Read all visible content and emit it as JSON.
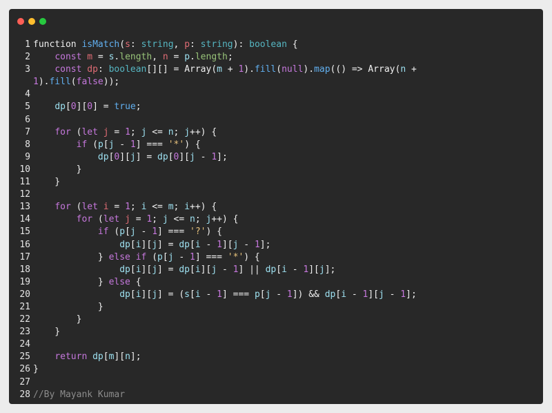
{
  "window": {
    "controls": [
      {
        "name": "close-dot",
        "color": "#ff5f56"
      },
      {
        "name": "minimize-dot",
        "color": "#ffbd2e"
      },
      {
        "name": "maximize-dot",
        "color": "#27c93f"
      }
    ]
  },
  "code": {
    "lines": [
      {
        "n": "1",
        "tokens": [
          [
            "plain",
            "function "
          ],
          [
            "fn",
            "isMatch"
          ],
          [
            "plain",
            "("
          ],
          [
            "var",
            "s"
          ],
          [
            "plain",
            ": "
          ],
          [
            "type",
            "string"
          ],
          [
            "plain",
            ", "
          ],
          [
            "var",
            "p"
          ],
          [
            "plain",
            ": "
          ],
          [
            "type",
            "string"
          ],
          [
            "plain",
            "): "
          ],
          [
            "type",
            "boolean"
          ],
          [
            "plain",
            " {"
          ]
        ]
      },
      {
        "n": "2",
        "tokens": [
          [
            "plain",
            "    "
          ],
          [
            "kw",
            "const "
          ],
          [
            "var",
            "m"
          ],
          [
            "plain",
            " = "
          ],
          [
            "idx",
            "s"
          ],
          [
            "plain",
            "."
          ],
          [
            "prop",
            "length"
          ],
          [
            "plain",
            ", "
          ],
          [
            "var",
            "n"
          ],
          [
            "plain",
            " = "
          ],
          [
            "idx",
            "p"
          ],
          [
            "plain",
            "."
          ],
          [
            "prop",
            "length"
          ],
          [
            "plain",
            ";"
          ]
        ]
      },
      {
        "n": "3",
        "tokens": [
          [
            "plain",
            "    "
          ],
          [
            "kw",
            "const "
          ],
          [
            "var",
            "dp"
          ],
          [
            "plain",
            ": "
          ],
          [
            "type",
            "boolean"
          ],
          [
            "plain",
            "[][] = "
          ],
          [
            "fnplain",
            "Array"
          ],
          [
            "plain",
            "("
          ],
          [
            "idx",
            "m"
          ],
          [
            "plain",
            " + "
          ],
          [
            "num",
            "1"
          ],
          [
            "plain",
            ")."
          ],
          [
            "fn",
            "fill"
          ],
          [
            "plain",
            "("
          ],
          [
            "kw",
            "null"
          ],
          [
            "plain",
            ")."
          ],
          [
            "fn",
            "map"
          ],
          [
            "plain",
            "(() => "
          ],
          [
            "fnplain",
            "Array"
          ],
          [
            "plain",
            "("
          ],
          [
            "idx",
            "n"
          ],
          [
            "plain",
            " +"
          ]
        ]
      },
      {
        "n": "",
        "cont": true,
        "tokens": [
          [
            "num",
            "1"
          ],
          [
            "plain",
            ")."
          ],
          [
            "fn",
            "fill"
          ],
          [
            "plain",
            "("
          ],
          [
            "kw",
            "false"
          ],
          [
            "plain",
            "));"
          ]
        ]
      },
      {
        "n": "4",
        "tokens": []
      },
      {
        "n": "5",
        "tokens": [
          [
            "plain",
            "    "
          ],
          [
            "idx",
            "dp"
          ],
          [
            "plain",
            "["
          ],
          [
            "num",
            "0"
          ],
          [
            "plain",
            "]["
          ],
          [
            "num",
            "0"
          ],
          [
            "plain",
            "] = "
          ],
          [
            "lit",
            "true"
          ],
          [
            "plain",
            ";"
          ]
        ]
      },
      {
        "n": "6",
        "tokens": []
      },
      {
        "n": "7",
        "tokens": [
          [
            "plain",
            "    "
          ],
          [
            "kw",
            "for"
          ],
          [
            "plain",
            " ("
          ],
          [
            "kw",
            "let "
          ],
          [
            "var",
            "j"
          ],
          [
            "plain",
            " = "
          ],
          [
            "num",
            "1"
          ],
          [
            "plain",
            "; "
          ],
          [
            "idx",
            "j"
          ],
          [
            "plain",
            " <= "
          ],
          [
            "idx",
            "n"
          ],
          [
            "plain",
            "; "
          ],
          [
            "idx",
            "j"
          ],
          [
            "plain",
            "++) {"
          ]
        ]
      },
      {
        "n": "8",
        "tokens": [
          [
            "plain",
            "        "
          ],
          [
            "kw",
            "if"
          ],
          [
            "plain",
            " ("
          ],
          [
            "idx",
            "p"
          ],
          [
            "plain",
            "["
          ],
          [
            "idx",
            "j"
          ],
          [
            "plain",
            " - "
          ],
          [
            "num",
            "1"
          ],
          [
            "plain",
            "] === "
          ],
          [
            "str",
            "'*'"
          ],
          [
            "plain",
            ") {"
          ]
        ]
      },
      {
        "n": "9",
        "tokens": [
          [
            "plain",
            "            "
          ],
          [
            "idx",
            "dp"
          ],
          [
            "plain",
            "["
          ],
          [
            "num",
            "0"
          ],
          [
            "plain",
            "]["
          ],
          [
            "idx",
            "j"
          ],
          [
            "plain",
            "] = "
          ],
          [
            "idx",
            "dp"
          ],
          [
            "plain",
            "["
          ],
          [
            "num",
            "0"
          ],
          [
            "plain",
            "]["
          ],
          [
            "idx",
            "j"
          ],
          [
            "plain",
            " - "
          ],
          [
            "num",
            "1"
          ],
          [
            "plain",
            "];"
          ]
        ]
      },
      {
        "n": "10",
        "tokens": [
          [
            "plain",
            "        }"
          ]
        ]
      },
      {
        "n": "11",
        "tokens": [
          [
            "plain",
            "    }"
          ]
        ]
      },
      {
        "n": "12",
        "tokens": []
      },
      {
        "n": "13",
        "tokens": [
          [
            "plain",
            "    "
          ],
          [
            "kw",
            "for"
          ],
          [
            "plain",
            " ("
          ],
          [
            "kw",
            "let "
          ],
          [
            "var",
            "i"
          ],
          [
            "plain",
            " = "
          ],
          [
            "num",
            "1"
          ],
          [
            "plain",
            "; "
          ],
          [
            "idx",
            "i"
          ],
          [
            "plain",
            " <= "
          ],
          [
            "idx",
            "m"
          ],
          [
            "plain",
            "; "
          ],
          [
            "idx",
            "i"
          ],
          [
            "plain",
            "++) {"
          ]
        ]
      },
      {
        "n": "14",
        "tokens": [
          [
            "plain",
            "        "
          ],
          [
            "kw",
            "for"
          ],
          [
            "plain",
            " ("
          ],
          [
            "kw",
            "let "
          ],
          [
            "var",
            "j"
          ],
          [
            "plain",
            " = "
          ],
          [
            "num",
            "1"
          ],
          [
            "plain",
            "; "
          ],
          [
            "idx",
            "j"
          ],
          [
            "plain",
            " <= "
          ],
          [
            "idx",
            "n"
          ],
          [
            "plain",
            "; "
          ],
          [
            "idx",
            "j"
          ],
          [
            "plain",
            "++) {"
          ]
        ]
      },
      {
        "n": "15",
        "tokens": [
          [
            "plain",
            "            "
          ],
          [
            "kw",
            "if"
          ],
          [
            "plain",
            " ("
          ],
          [
            "idx",
            "p"
          ],
          [
            "plain",
            "["
          ],
          [
            "idx",
            "j"
          ],
          [
            "plain",
            " - "
          ],
          [
            "num",
            "1"
          ],
          [
            "plain",
            "] === "
          ],
          [
            "str",
            "'?'"
          ],
          [
            "plain",
            ") {"
          ]
        ]
      },
      {
        "n": "16",
        "tokens": [
          [
            "plain",
            "                "
          ],
          [
            "idx",
            "dp"
          ],
          [
            "plain",
            "["
          ],
          [
            "idx",
            "i"
          ],
          [
            "plain",
            "]["
          ],
          [
            "idx",
            "j"
          ],
          [
            "plain",
            "] = "
          ],
          [
            "idx",
            "dp"
          ],
          [
            "plain",
            "["
          ],
          [
            "idx",
            "i"
          ],
          [
            "plain",
            " - "
          ],
          [
            "num",
            "1"
          ],
          [
            "plain",
            "]["
          ],
          [
            "idx",
            "j"
          ],
          [
            "plain",
            " - "
          ],
          [
            "num",
            "1"
          ],
          [
            "plain",
            "];"
          ]
        ]
      },
      {
        "n": "17",
        "tokens": [
          [
            "plain",
            "            } "
          ],
          [
            "kw",
            "else if"
          ],
          [
            "plain",
            " ("
          ],
          [
            "idx",
            "p"
          ],
          [
            "plain",
            "["
          ],
          [
            "idx",
            "j"
          ],
          [
            "plain",
            " - "
          ],
          [
            "num",
            "1"
          ],
          [
            "plain",
            "] === "
          ],
          [
            "str",
            "'*'"
          ],
          [
            "plain",
            ") {"
          ]
        ]
      },
      {
        "n": "18",
        "tokens": [
          [
            "plain",
            "                "
          ],
          [
            "idx",
            "dp"
          ],
          [
            "plain",
            "["
          ],
          [
            "idx",
            "i"
          ],
          [
            "plain",
            "]["
          ],
          [
            "idx",
            "j"
          ],
          [
            "plain",
            "] = "
          ],
          [
            "idx",
            "dp"
          ],
          [
            "plain",
            "["
          ],
          [
            "idx",
            "i"
          ],
          [
            "plain",
            "]["
          ],
          [
            "idx",
            "j"
          ],
          [
            "plain",
            " - "
          ],
          [
            "num",
            "1"
          ],
          [
            "plain",
            "] || "
          ],
          [
            "idx",
            "dp"
          ],
          [
            "plain",
            "["
          ],
          [
            "idx",
            "i"
          ],
          [
            "plain",
            " - "
          ],
          [
            "num",
            "1"
          ],
          [
            "plain",
            "]["
          ],
          [
            "idx",
            "j"
          ],
          [
            "plain",
            "];"
          ]
        ]
      },
      {
        "n": "19",
        "tokens": [
          [
            "plain",
            "            } "
          ],
          [
            "kw",
            "else"
          ],
          [
            "plain",
            " {"
          ]
        ]
      },
      {
        "n": "20",
        "tokens": [
          [
            "plain",
            "                "
          ],
          [
            "idx",
            "dp"
          ],
          [
            "plain",
            "["
          ],
          [
            "idx",
            "i"
          ],
          [
            "plain",
            "]["
          ],
          [
            "idx",
            "j"
          ],
          [
            "plain",
            "] = ("
          ],
          [
            "idx",
            "s"
          ],
          [
            "plain",
            "["
          ],
          [
            "idx",
            "i"
          ],
          [
            "plain",
            " - "
          ],
          [
            "num",
            "1"
          ],
          [
            "plain",
            "] === "
          ],
          [
            "idx",
            "p"
          ],
          [
            "plain",
            "["
          ],
          [
            "idx",
            "j"
          ],
          [
            "plain",
            " - "
          ],
          [
            "num",
            "1"
          ],
          [
            "plain",
            "]) && "
          ],
          [
            "idx",
            "dp"
          ],
          [
            "plain",
            "["
          ],
          [
            "idx",
            "i"
          ],
          [
            "plain",
            " - "
          ],
          [
            "num",
            "1"
          ],
          [
            "plain",
            "]["
          ],
          [
            "idx",
            "j"
          ],
          [
            "plain",
            " - "
          ],
          [
            "num",
            "1"
          ],
          [
            "plain",
            "];"
          ]
        ]
      },
      {
        "n": "21",
        "tokens": [
          [
            "plain",
            "            }"
          ]
        ]
      },
      {
        "n": "22",
        "tokens": [
          [
            "plain",
            "        }"
          ]
        ]
      },
      {
        "n": "23",
        "tokens": [
          [
            "plain",
            "    }"
          ]
        ]
      },
      {
        "n": "24",
        "tokens": []
      },
      {
        "n": "25",
        "tokens": [
          [
            "plain",
            "    "
          ],
          [
            "kw",
            "return "
          ],
          [
            "idx",
            "dp"
          ],
          [
            "plain",
            "["
          ],
          [
            "idx",
            "m"
          ],
          [
            "plain",
            "]["
          ],
          [
            "idx",
            "n"
          ],
          [
            "plain",
            "];"
          ]
        ]
      },
      {
        "n": "26",
        "tokens": [
          [
            "plain",
            "}"
          ]
        ]
      },
      {
        "n": "27",
        "tokens": []
      },
      {
        "n": "28",
        "tokens": [
          [
            "com",
            "//By Mayank Kumar"
          ]
        ]
      }
    ]
  }
}
